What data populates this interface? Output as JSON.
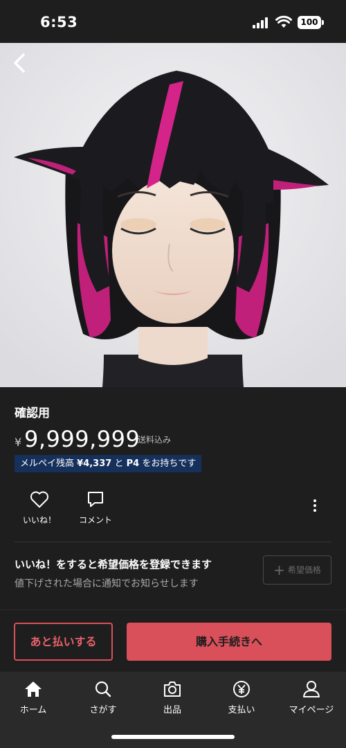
{
  "status_bar": {
    "time": "6:53",
    "battery": "100"
  },
  "product": {
    "title": "確認用",
    "currency_symbol": "¥",
    "price": "9,999,999",
    "shipping": "送料込み",
    "merpay": {
      "prefix": "メルペイ残高",
      "balance": "¥4,337",
      "connector": "と",
      "points": "P4",
      "suffix": "をお持ちです",
      "color": "#16305c"
    }
  },
  "actions": {
    "like_label": "いいね！",
    "comment_label": "コメント"
  },
  "wish_price": {
    "title": "いいね！をすると希望価格を登録できます",
    "subtitle": "値下げされた場合に通知でお知らせします",
    "button_label": "希望価格"
  },
  "purchase": {
    "later_pay_label": "あと払いする",
    "buy_label": "購入手続きへ",
    "accent_color": "#d9505a"
  },
  "tab_bar": {
    "items": [
      {
        "label": "ホーム",
        "icon": "home-icon"
      },
      {
        "label": "さがす",
        "icon": "search-icon"
      },
      {
        "label": "出品",
        "icon": "camera-icon"
      },
      {
        "label": "支払い",
        "icon": "yen-circle-icon"
      },
      {
        "label": "マイページ",
        "icon": "person-icon"
      }
    ]
  }
}
